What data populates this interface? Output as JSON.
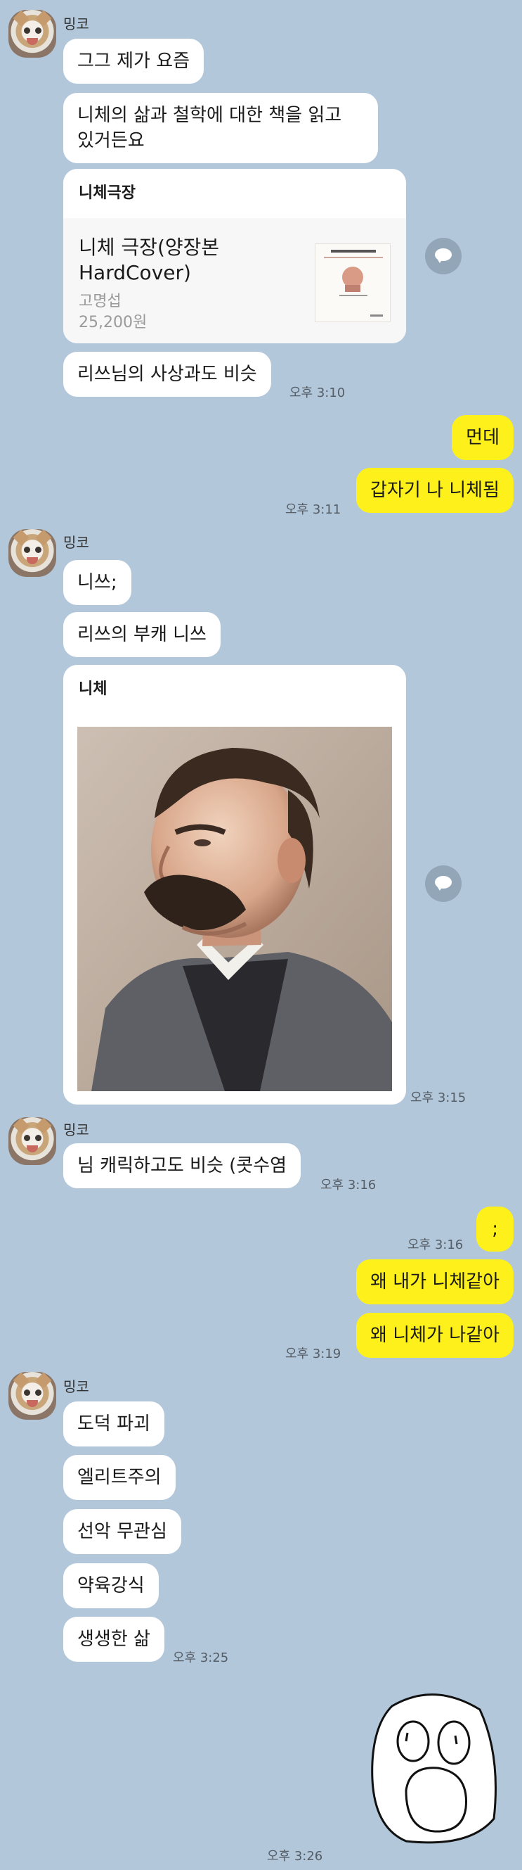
{
  "chat": {
    "group1": {
      "sender": "밍코",
      "m1": "그그 제가 요즘",
      "m2_line1": "니체의 삶과 철학에 대한 책을 읽고",
      "m2_line2": "있거든요",
      "book_card": {
        "header": "니체극장",
        "title_line1": "니체 극장(양장본",
        "title_line2": "HardCover)",
        "author": "고명섭",
        "price": "25,200원"
      },
      "m3": "리쓰님의 사상과도 비슷",
      "time": "오후 3:10"
    },
    "me1": {
      "m1": "먼데",
      "m2": "갑자기 나 니체됨",
      "time": "오후 3:11"
    },
    "group2": {
      "sender": "밍코",
      "m1": "니쓰;",
      "m2": "리쓰의 부캐 니쓰",
      "image_card": {
        "header": "니체"
      },
      "time": "오후 3:15"
    },
    "group3": {
      "sender": "밍코",
      "m1": "님 캐릭하고도 비슷 (콧수염",
      "time": "오후 3:16"
    },
    "me2": {
      "m1": ";",
      "m1_time": "오후 3:16",
      "m2": "왜 내가 니체같아",
      "m3": "왜 니체가 나같아",
      "time": "오후 3:19"
    },
    "group4": {
      "sender": "밍코",
      "m1": "도덕 파괴",
      "m2": "엘리트주의",
      "m3": "선악 무관심",
      "m4": "약육강식",
      "m5": "생생한 삶",
      "time": "오후 3:25"
    },
    "me3": {
      "sticker": "shocked-face-sticker",
      "time": "오후 3:26"
    }
  },
  "colors": {
    "background": "#b2c7da",
    "my_bubble": "#fef01b",
    "their_bubble": "#ffffff"
  }
}
